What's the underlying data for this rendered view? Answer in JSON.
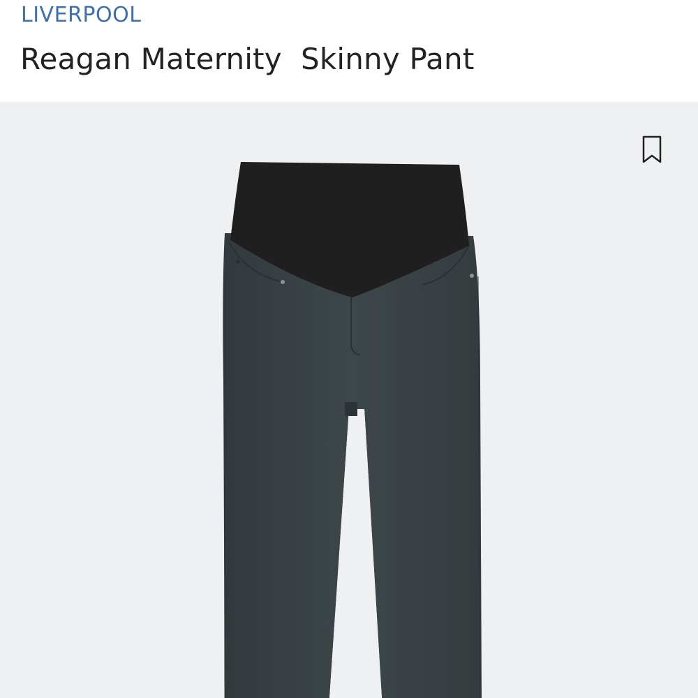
{
  "product": {
    "brand": "LIVERPOOL",
    "title": "Reagan Maternity  Skinny Pant"
  },
  "image": {
    "subject": "maternity-skinny-pant",
    "garment_color": "#3b4346",
    "band_color": "#1f1f1f",
    "background_color": "#eef0f2"
  },
  "icons": {
    "bookmark": "bookmark-icon"
  }
}
